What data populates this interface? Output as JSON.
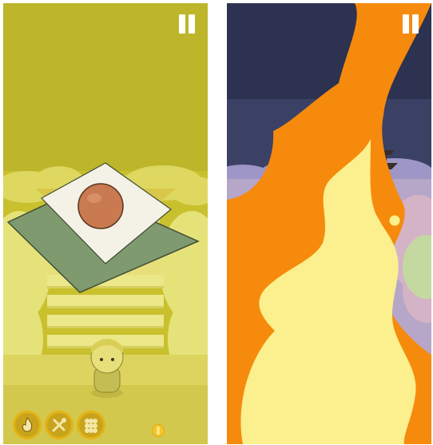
{
  "screens": [
    {
      "id": "left",
      "background_color": "#c9c02e",
      "pause_icon": "pause-icon",
      "hud": {
        "buttons": [
          "fire-icon",
          "tools-icon",
          "grid-icon"
        ],
        "currency_icon": "coin-icon"
      },
      "scene": {
        "object": "rice-cake-on-cushion",
        "character": "ninja-kid"
      }
    },
    {
      "id": "right",
      "background_color": "#2c3250",
      "pause_icon": "pause-icon",
      "scene": {
        "object": "flame-blast"
      }
    }
  ],
  "colors": {
    "gold": "#e5b315",
    "flame_orange": "#f68a0d",
    "flame_yellow": "#fbf08d",
    "cushion_green": "#7f9a6f"
  }
}
